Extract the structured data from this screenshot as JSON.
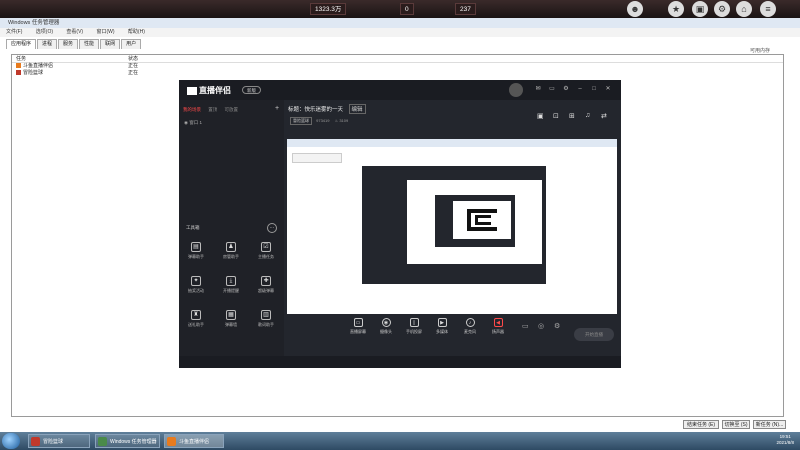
{
  "gamebar": {
    "resource1": "1323.3万",
    "resource2": "0",
    "resource3": "237"
  },
  "taskmanager": {
    "title": "Windows 任务管理器",
    "menu": [
      "文件(F)",
      "选项(O)",
      "查看(V)",
      "窗口(W)",
      "帮助(H)"
    ],
    "tabs": [
      "应用程序",
      "进程",
      "服务",
      "性能",
      "联网",
      "用户"
    ],
    "columns": {
      "task": "任务",
      "status": "状态"
    },
    "rows": [
      {
        "task": "斗鱼直播伴侣",
        "status": "正在"
      },
      {
        "task": "冒险篮球",
        "status": "正在"
      }
    ],
    "buttons": {
      "end": "结束任务 (E)",
      "switch": "切换至 (S)",
      "new": "新任务 (N)..."
    },
    "side_label": "可用内存"
  },
  "stream": {
    "app_name": "直播伴侣",
    "pill": "新版",
    "side_tabs": [
      "我的场景",
      "置顶",
      "可放置"
    ],
    "scene_line": "窗口 1",
    "room_title": "标题：快乐迷雾的一天",
    "room_badge": "编辑",
    "room_category": "冒险篮球",
    "room_id": "973419",
    "room_hot": "3109",
    "tools_title": "工具箱",
    "tools": [
      "弹幕助手",
      "房管助手",
      "主播任务",
      "抽奖活动",
      "开播提醒",
      "超级弹幕",
      "送礼助手",
      "弹幕墙",
      "歌词助手"
    ],
    "bottom_btns": [
      "直播屏幕",
      "摄像头",
      "手机投屏",
      "多媒体",
      "麦克风",
      "扬声器"
    ],
    "start_btn": "开始直播",
    "side_hint": "斗鱼直播伴侣使用教程"
  },
  "taskbar": {
    "items": [
      "冒险篮球",
      "Windows 任务管理器",
      "斗鱼直播伴侣"
    ],
    "time": "19:51",
    "date": "2021/8/8"
  },
  "colors": {
    "accent": "#ff4a4a",
    "stream_bg": "#23262d"
  }
}
